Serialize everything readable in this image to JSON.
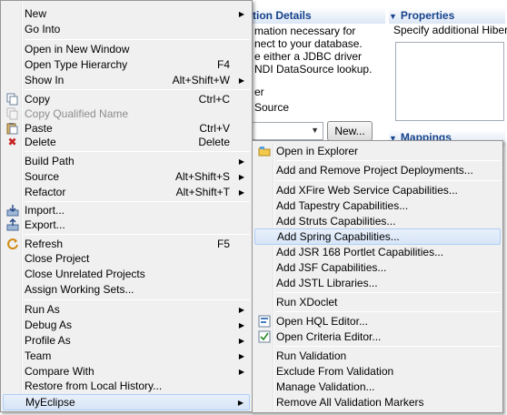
{
  "background": {
    "connection_header": "tion Details",
    "properties_header": "Properties",
    "properties_text": "Specify additional Hiber",
    "connection_lines": [
      "mation necessary for",
      "nect to your database.",
      "e either a JDBC driver",
      "NDI DataSource lookup."
    ],
    "option_labels": [
      "er",
      "Source"
    ],
    "new_button": "New...",
    "mappings_header": "Mappings"
  },
  "main_menu": {
    "items": [
      {
        "label": "New",
        "accel": "",
        "submenu": true
      },
      {
        "label": "Go Into",
        "accel": ""
      },
      {
        "label": "Open in New Window",
        "accel": ""
      },
      {
        "label": "Open Type Hierarchy",
        "accel": "F4"
      },
      {
        "label": "Show In",
        "accel": "Alt+Shift+W",
        "submenu": true
      },
      {
        "label": "Copy",
        "accel": "Ctrl+C",
        "icon": "copy-icon"
      },
      {
        "label": "Copy Qualified Name",
        "accel": "",
        "disabled": true,
        "icon": "copy-qualified-name-icon"
      },
      {
        "label": "Paste",
        "accel": "Ctrl+V",
        "icon": "paste-icon"
      },
      {
        "label": "Delete",
        "accel": "Delete",
        "icon": "delete-icon"
      },
      {
        "label": "Build Path",
        "accel": "",
        "submenu": true
      },
      {
        "label": "Source",
        "accel": "Alt+Shift+S",
        "submenu": true
      },
      {
        "label": "Refactor",
        "accel": "Alt+Shift+T",
        "submenu": true
      },
      {
        "label": "Import...",
        "accel": "",
        "icon": "import-icon"
      },
      {
        "label": "Export...",
        "accel": "",
        "icon": "export-icon"
      },
      {
        "label": "Refresh",
        "accel": "F5",
        "icon": "refresh-icon"
      },
      {
        "label": "Close Project",
        "accel": ""
      },
      {
        "label": "Close Unrelated Projects",
        "accel": ""
      },
      {
        "label": "Assign Working Sets...",
        "accel": ""
      },
      {
        "label": "Run As",
        "accel": "",
        "submenu": true
      },
      {
        "label": "Debug As",
        "accel": "",
        "submenu": true
      },
      {
        "label": "Profile As",
        "accel": "",
        "submenu": true
      },
      {
        "label": "Team",
        "accel": "",
        "submenu": true
      },
      {
        "label": "Compare With",
        "accel": "",
        "submenu": true
      },
      {
        "label": "Restore from Local History...",
        "accel": ""
      },
      {
        "label": "MyEclipse",
        "accel": "",
        "submenu": true,
        "highlighted": true
      }
    ]
  },
  "myeclipse_submenu": {
    "items": [
      {
        "label": "Open in Explorer",
        "icon": "folder-explorer-icon"
      },
      {
        "label": "Add and Remove Project Deployments..."
      },
      {
        "label": "Add XFire Web Service Capabilities..."
      },
      {
        "label": "Add Tapestry Capabilities..."
      },
      {
        "label": "Add Struts Capabilities..."
      },
      {
        "label": "Add Spring Capabilities...",
        "highlighted": true
      },
      {
        "label": "Add JSR 168 Portlet Capabilities..."
      },
      {
        "label": "Add JSF Capabilities..."
      },
      {
        "label": "Add JSTL Libraries..."
      },
      {
        "label": "Run XDoclet"
      },
      {
        "label": "Open HQL Editor...",
        "icon": "hql-editor-icon"
      },
      {
        "label": "Open Criteria Editor...",
        "icon": "criteria-editor-icon"
      },
      {
        "label": "Run Validation"
      },
      {
        "label": "Exclude From Validation"
      },
      {
        "label": "Manage Validation..."
      },
      {
        "label": "Remove All Validation Markers"
      }
    ]
  },
  "colors": {
    "menu_background": "#f0f0f0",
    "highlight": "#d7e5f7",
    "section_header_text": "#15428b",
    "delete_icon": "#c82020"
  }
}
